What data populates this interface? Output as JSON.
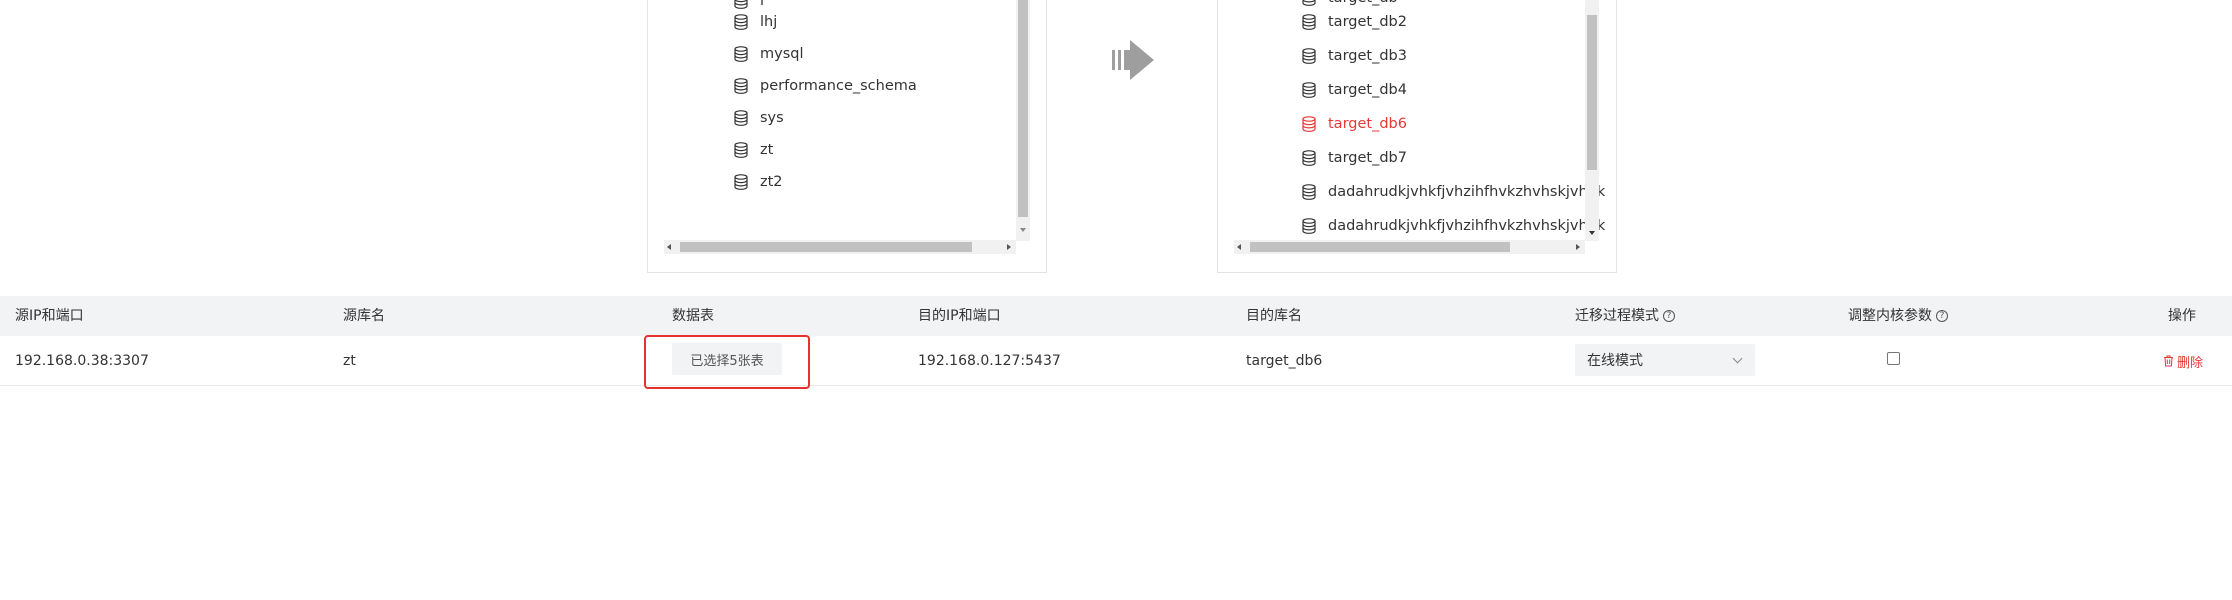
{
  "source_tree": {
    "items": [
      "lhj",
      "mysql",
      "performance_schema",
      "sys",
      "zt",
      "zt2"
    ],
    "partial_top_item": "i"
  },
  "target_tree": {
    "partial_top_item": "target_db",
    "items": [
      "target_db2",
      "target_db3",
      "target_db4",
      "target_db6",
      "target_db7",
      "dadahrudkjvhkfjvhzihfhvkzhvhskjvhhk",
      "dadahrudkjvhkfjvhzihfhvkzhvhskjvhhk"
    ],
    "selected": "target_db6"
  },
  "table": {
    "headers": {
      "source_ip_port": "源IP和端口",
      "source_db": "源库名",
      "data_tables": "数据表",
      "target_ip_port": "目的IP和端口",
      "target_db": "目的库名",
      "migration_mode": "迁移过程模式",
      "kernel_params": "调整内核参数",
      "actions": "操作"
    },
    "help_glyph": "?",
    "row": {
      "source_ip_port": "192.168.0.38:3307",
      "source_db": "zt",
      "tables_button": "已选择5张表",
      "target_ip_port": "192.168.0.127:5437",
      "target_db": "target_db6",
      "migration_mode": "在线模式",
      "kernel_params_checked": false,
      "delete_label": "删除"
    }
  },
  "colors": {
    "accent_red": "#e53935",
    "header_bg": "#f2f3f5",
    "highlight_border": "#e8312f"
  }
}
